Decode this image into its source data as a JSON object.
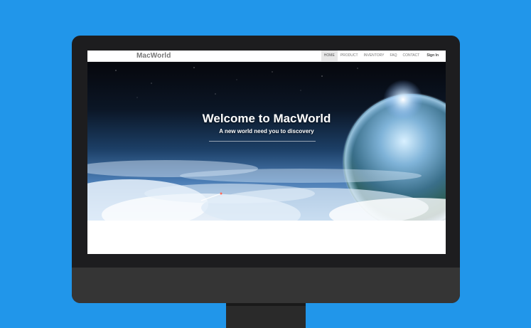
{
  "site": {
    "brand": "MacWorld",
    "nav": [
      {
        "label": "HOME",
        "active": true
      },
      {
        "label": "PRODUCT",
        "active": false
      },
      {
        "label": "INVENTORY",
        "active": false
      },
      {
        "label": "FAQ",
        "active": false
      },
      {
        "label": "CONTACT",
        "active": false
      }
    ],
    "sign_in": "Sign In"
  },
  "hero": {
    "title": "Welcome to MacWorld",
    "subtitle": "A new world need you to discovery"
  },
  "colors": {
    "background": "#2196ea",
    "monitor_frame": "#1d1d1f",
    "monitor_chin": "#353535",
    "nav_active_bg": "#e7e7e7"
  }
}
